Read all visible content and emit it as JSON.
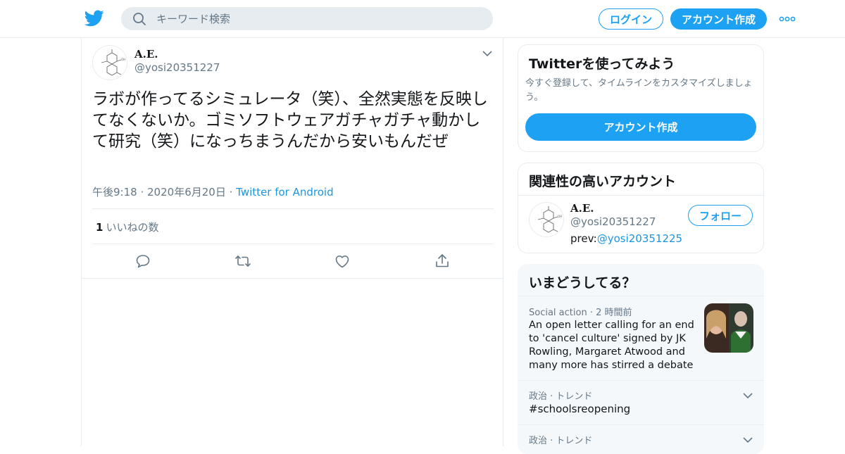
{
  "header": {
    "logo_icon": "twitter-bird-icon",
    "search_placeholder": "キーワード検索",
    "login_label": "ログイン",
    "signup_label": "アカウント作成",
    "more_icon": "more-dots-icon",
    "accent": "#1da1f2"
  },
  "tweet": {
    "name": "A.E.",
    "handle": "@yosi20351227",
    "text": "ラボが作ってるシミュレータ（笑）、全然実態を反映してなくないか。ゴミソフトウェアガチャガチャ動かして研究（笑）になっちまうんだから安いもんだぜ",
    "time": "午後9:18",
    "date": "2020年6月20日",
    "source": "Twitter for Android",
    "like_count": "1",
    "like_label": "いいねの数"
  },
  "join_card": {
    "title": "Twitterを使ってみよう",
    "description": "今すぐ登録して、タイムラインをカスタマイズしましょう。",
    "button_label": "アカウント作成"
  },
  "related_card": {
    "title": "関連性の高いアカウント",
    "name": "A.E.",
    "handle": "@yosi20351227",
    "bio_prefix": "prev:",
    "bio_link": "@yosi20351225",
    "follow_label": "フォロー"
  },
  "trends_card": {
    "title": "いまどうしてる？",
    "items": [
      {
        "category": "Social action · 2 時間前",
        "text": "An open letter calling for an end to 'cancel culture' signed by JK Rowling, Margaret Atwood and many more has stirred a debate"
      },
      {
        "category": "政治 · トレンド",
        "text": "#schoolsreopening"
      },
      {
        "category": "政治 · トレンド",
        "text": ""
      }
    ]
  }
}
